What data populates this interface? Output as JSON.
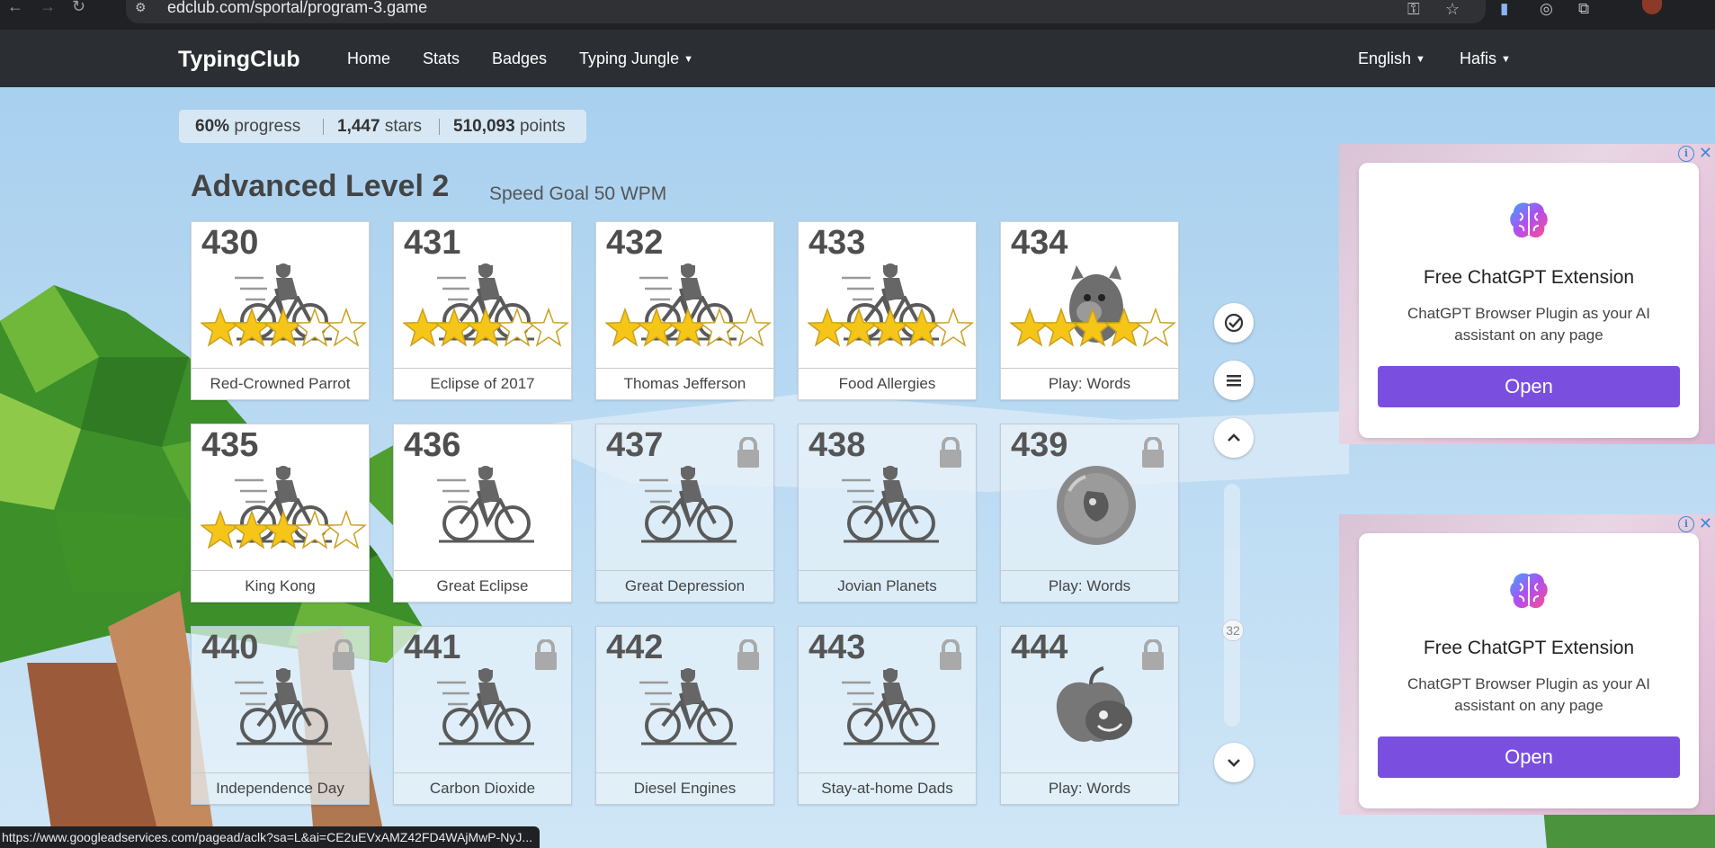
{
  "browser": {
    "url": "edclub.com/sportal/program-3.game",
    "status_url": "https://www.googleadservices.com/pagead/aclk?sa=L&ai=CE2uEVxAMZ42FD4WAjMwP-NyJ..."
  },
  "nav": {
    "brand": "TypingClub",
    "links": [
      "Home",
      "Stats",
      "Badges",
      "Typing Jungle"
    ],
    "language": "English",
    "user": "Hafis"
  },
  "progress": {
    "percent": "60%",
    "percent_label": "progress",
    "stars": "1,447",
    "stars_label": "stars",
    "points": "510,093",
    "points_label": "points"
  },
  "level": {
    "title": "Advanced Level 2",
    "subtitle": "Speed Goal 50 WPM"
  },
  "lessons": [
    {
      "num": "430",
      "name": "Red-Crowned Parrot",
      "icon": "cyclist-icon",
      "stars": 3,
      "locked": false
    },
    {
      "num": "431",
      "name": "Eclipse of 2017",
      "icon": "cyclist-icon",
      "stars": 3,
      "locked": false
    },
    {
      "num": "432",
      "name": "Thomas Jefferson",
      "icon": "cyclist-icon",
      "stars": 3,
      "locked": false
    },
    {
      "num": "433",
      "name": "Food Allergies",
      "icon": "cyclist-icon",
      "stars": 4,
      "locked": false
    },
    {
      "num": "434",
      "name": "Play: Words",
      "icon": "monster-icon",
      "stars": 4,
      "locked": false
    },
    {
      "num": "435",
      "name": "King Kong",
      "icon": "cyclist-icon",
      "stars": 3,
      "locked": false
    },
    {
      "num": "436",
      "name": "Great Eclipse",
      "icon": "cyclist-icon",
      "stars": 0,
      "locked": false
    },
    {
      "num": "437",
      "name": "Great Depression",
      "icon": "cyclist-icon",
      "stars": 0,
      "locked": true
    },
    {
      "num": "438",
      "name": "Jovian Planets",
      "icon": "cyclist-icon",
      "stars": 0,
      "locked": true
    },
    {
      "num": "439",
      "name": "Play: Words",
      "icon": "bubble-creature-icon",
      "stars": 0,
      "locked": true
    },
    {
      "num": "440",
      "name": "Independence Day",
      "icon": "cyclist-icon",
      "stars": 0,
      "locked": true
    },
    {
      "num": "441",
      "name": "Carbon Dioxide",
      "icon": "cyclist-icon",
      "stars": 0,
      "locked": true
    },
    {
      "num": "442",
      "name": "Diesel Engines",
      "icon": "cyclist-icon",
      "stars": 0,
      "locked": true
    },
    {
      "num": "443",
      "name": "Stay-at-home Dads",
      "icon": "cyclist-icon",
      "stars": 0,
      "locked": true
    },
    {
      "num": "444",
      "name": "Play: Words",
      "icon": "apple-creature-icon",
      "stars": 0,
      "locked": true
    }
  ],
  "scroll": {
    "position_label": "32"
  },
  "ads": [
    {
      "title": "Free ChatGPT Extension",
      "desc": "ChatGPT Browser Plugin as your AI assistant on any page",
      "button": "Open",
      "info": "i",
      "close": "✕"
    },
    {
      "title": "Free ChatGPT Extension",
      "desc": "ChatGPT Browser Plugin as your AI assistant on any page",
      "button": "Open",
      "info": "i",
      "close": "✕"
    }
  ],
  "colors": {
    "nav_bg": "#2b2f33",
    "sky": "#b8d9f2",
    "star_gold": "#f5c518",
    "ad_button": "#7a4fe0"
  }
}
